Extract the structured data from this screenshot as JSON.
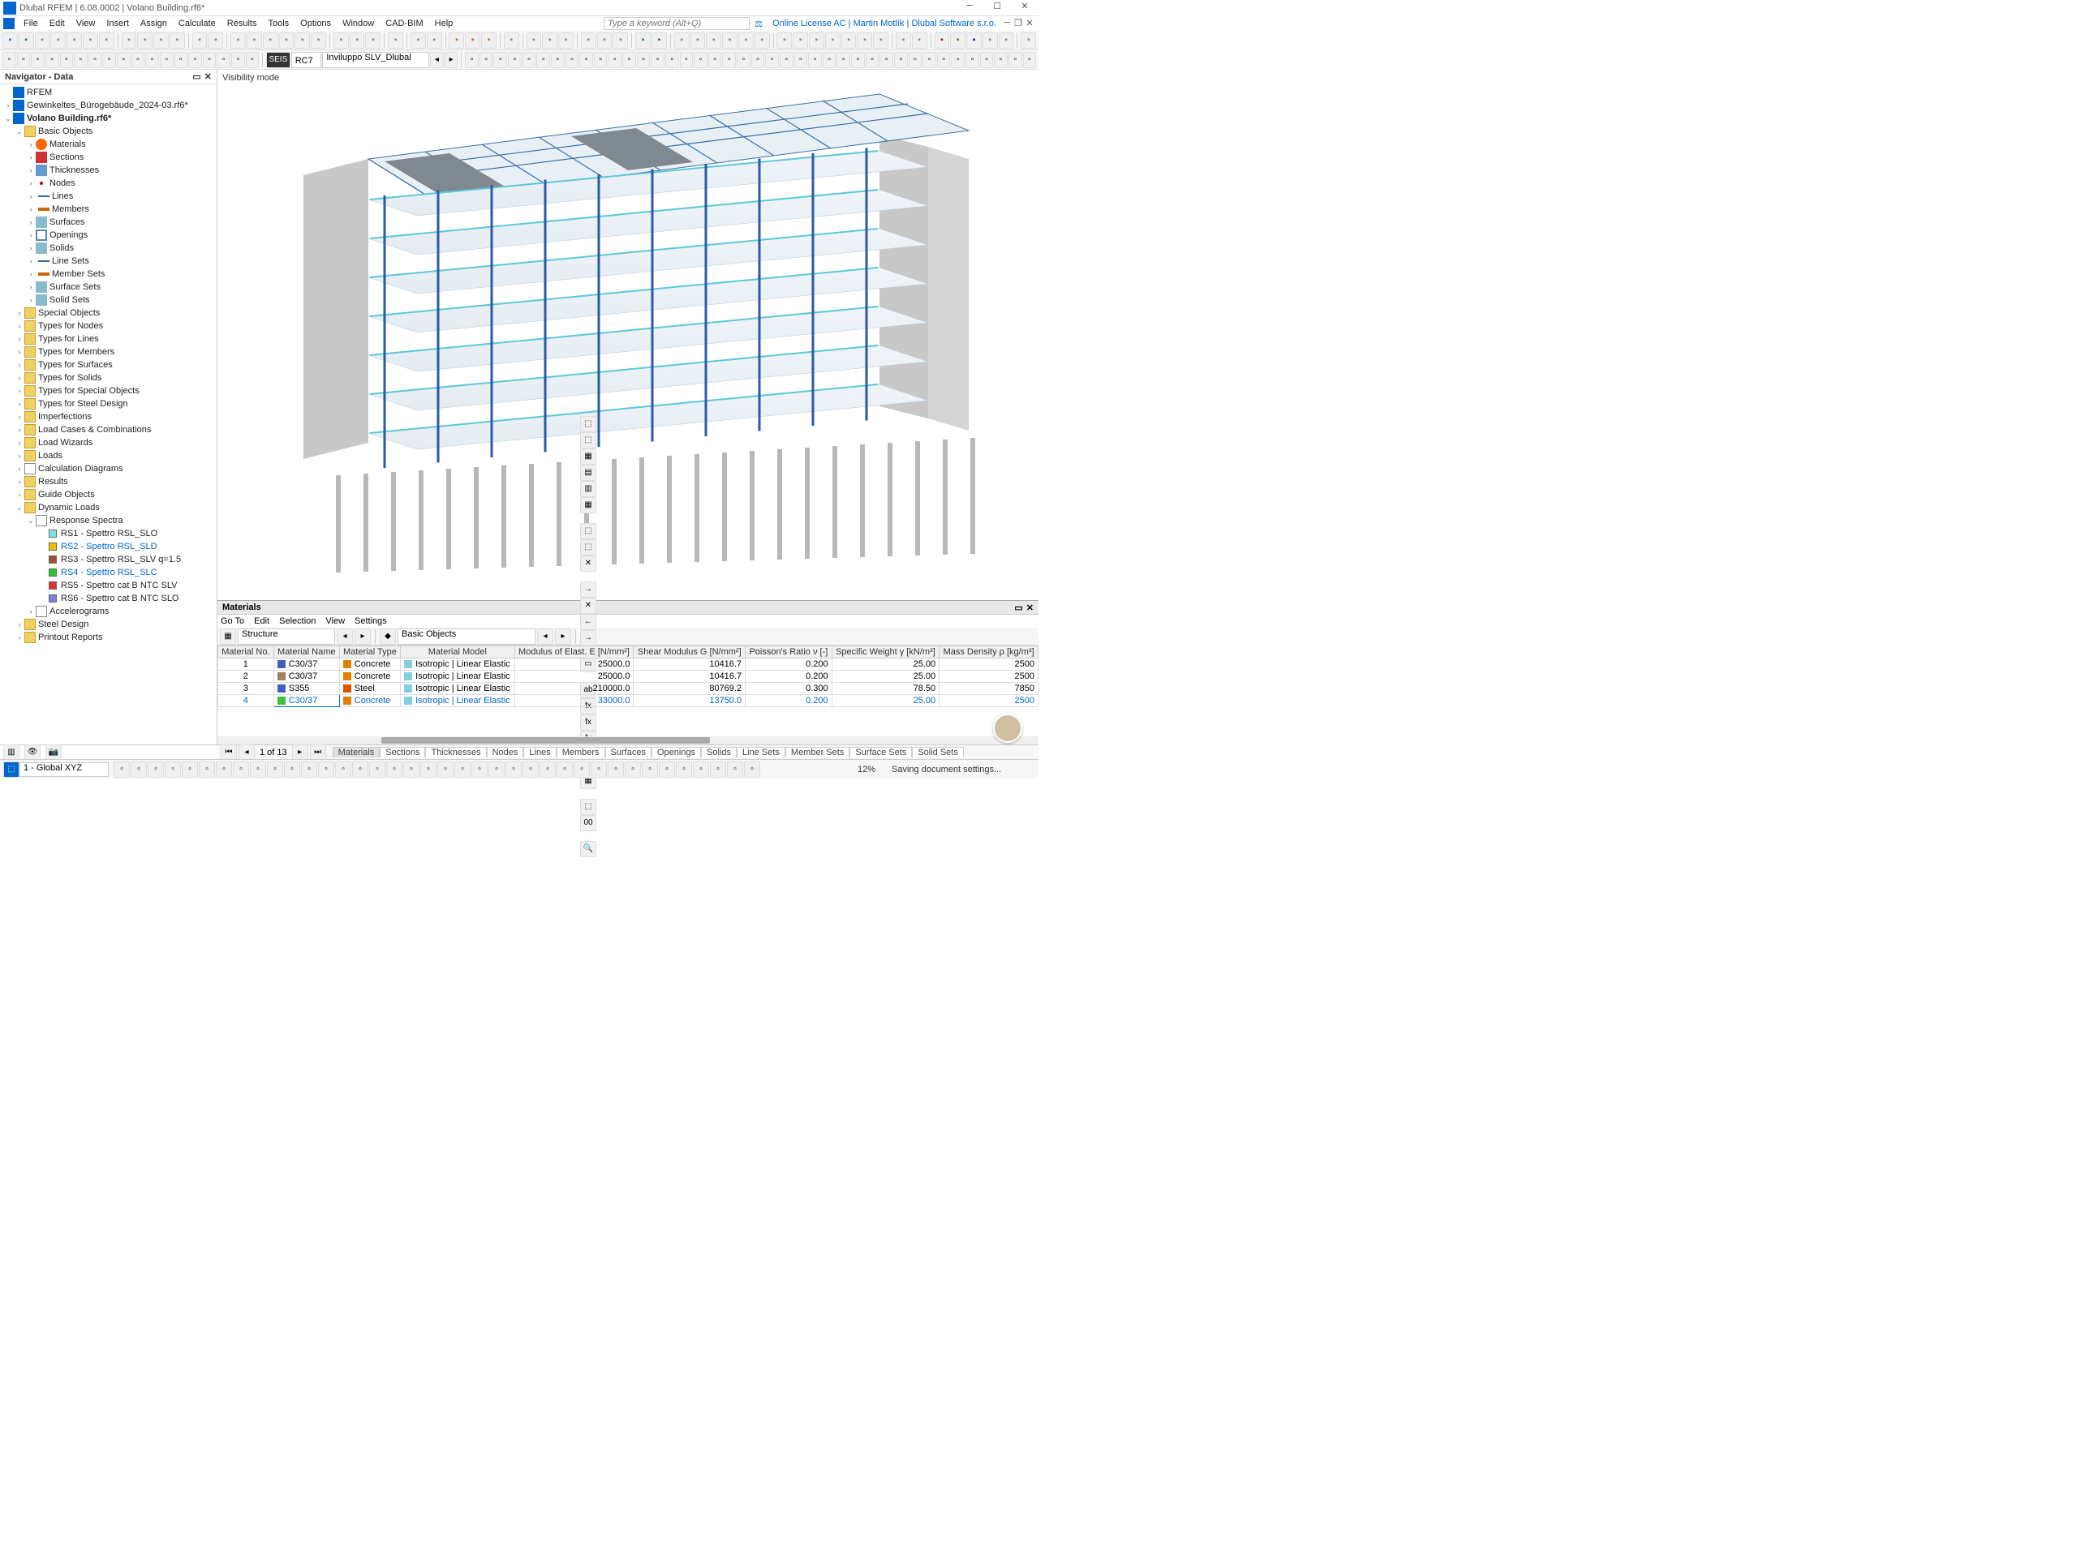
{
  "title": "Dlubal RFEM | 6.08.0002 | Volano Building.rf6*",
  "menus": [
    "File",
    "Edit",
    "View",
    "Insert",
    "Assign",
    "Calculate",
    "Results",
    "Tools",
    "Options",
    "Window",
    "CAD-BIM",
    "Help"
  ],
  "search_placeholder": "Type a keyword (Alt+Q)",
  "license": "Online License AC | Martin Motlík | Dlubal Software s.r.o.",
  "toolbar2": {
    "seis": "SEIS",
    "rc": "RC7",
    "case": "Inviluppo SLV_Dlubal"
  },
  "navigator": {
    "title": "Navigator - Data",
    "root": "RFEM",
    "file1": "Gewinkeltes_Bürogebäude_2024-03.rf6*",
    "file2": "Volano Building.rf6*",
    "basic": "Basic Objects",
    "items": [
      "Materials",
      "Sections",
      "Thicknesses",
      "Nodes",
      "Lines",
      "Members",
      "Surfaces",
      "Openings",
      "Solids",
      "Line Sets",
      "Member Sets",
      "Surface Sets",
      "Solid Sets"
    ],
    "groups": [
      "Special Objects",
      "Types for Nodes",
      "Types for Lines",
      "Types for Members",
      "Types for Surfaces",
      "Types for Solids",
      "Types for Special Objects",
      "Types for Steel Design",
      "Imperfections",
      "Load Cases & Combinations",
      "Load Wizards",
      "Loads",
      "Calculation Diagrams",
      "Results",
      "Guide Objects"
    ],
    "dyn": "Dynamic Loads",
    "rs": "Response Spectra",
    "rsitems": [
      {
        "label": "RS1 - Spettro RSL_SLO",
        "color": "#80e0e0",
        "blue": false
      },
      {
        "label": "RS2 - Spettro RSL_SLD",
        "color": "#f0c000",
        "blue": true
      },
      {
        "label": "RS3 - Spettro RSL_SLV q=1.5",
        "color": "#a05030",
        "blue": false
      },
      {
        "label": "RS4 - Spettro RSL_SLC",
        "color": "#30c030",
        "blue": true
      },
      {
        "label": "RS5 - Spettro cat B NTC SLV",
        "color": "#e03030",
        "blue": false
      },
      {
        "label": "RS6 - Spettro cat B NTC SLO",
        "color": "#8080e0",
        "blue": false
      }
    ],
    "accel": "Accelerograms",
    "tail": [
      "Steel Design",
      "Printout Reports"
    ]
  },
  "viewport": {
    "label": "Visibility mode"
  },
  "materials": {
    "title": "Materials",
    "menu": [
      "Go To",
      "Edit",
      "Selection",
      "View",
      "Settings"
    ],
    "combo1": "Structure",
    "combo2": "Basic Objects",
    "headers": [
      "Material\nNo.",
      "Material Name",
      "Material\nType",
      "Material Model",
      "Modulus of Elast.\nE [N/mm²]",
      "Shear Modulus\nG [N/mm²]",
      "Poisson's Ratio\nν [-]",
      "Specific Weight\nγ [kN/m³]",
      "Mass Density\nρ [kg/m³]"
    ],
    "rows": [
      {
        "no": "1",
        "name": "C30/37",
        "sw": "#4060c0",
        "type": "Concrete",
        "tsw": "#e08000",
        "model": "Isotropic | Linear Elastic",
        "msw": "#80d0e0",
        "E": "25000.0",
        "G": "10416.7",
        "v": "0.200",
        "gw": "25.00",
        "rho": "2500"
      },
      {
        "no": "2",
        "name": "C30/37",
        "sw": "#a08060",
        "type": "Concrete",
        "tsw": "#e08000",
        "model": "Isotropic | Linear Elastic",
        "msw": "#80d0e0",
        "E": "25000.0",
        "G": "10416.7",
        "v": "0.200",
        "gw": "25.00",
        "rho": "2500"
      },
      {
        "no": "3",
        "name": "S355",
        "sw": "#4060c0",
        "type": "Steel",
        "tsw": "#e05000",
        "model": "Isotropic | Linear Elastic",
        "msw": "#80d0e0",
        "E": "210000.0",
        "G": "80769.2",
        "v": "0.300",
        "gw": "78.50",
        "rho": "7850"
      },
      {
        "no": "4",
        "name": "C30/37",
        "sw": "#40c040",
        "type": "Concrete",
        "tsw": "#e08000",
        "model": "Isotropic | Linear Elastic",
        "msw": "#80d0e0",
        "E": "33000.0",
        "G": "13750.0",
        "v": "0.200",
        "gw": "25.00",
        "rho": "2500",
        "sel": true
      }
    ]
  },
  "bottomtabs": {
    "page": "1 of 13",
    "tabs": [
      "Materials",
      "Sections",
      "Thicknesses",
      "Nodes",
      "Lines",
      "Members",
      "Surfaces",
      "Openings",
      "Solids",
      "Line Sets",
      "Member Sets",
      "Surface Sets",
      "Solid Sets"
    ]
  },
  "bottombar": {
    "coord": "1 - Global XYZ",
    "pct": "12%",
    "msg": "Saving document settings..."
  }
}
